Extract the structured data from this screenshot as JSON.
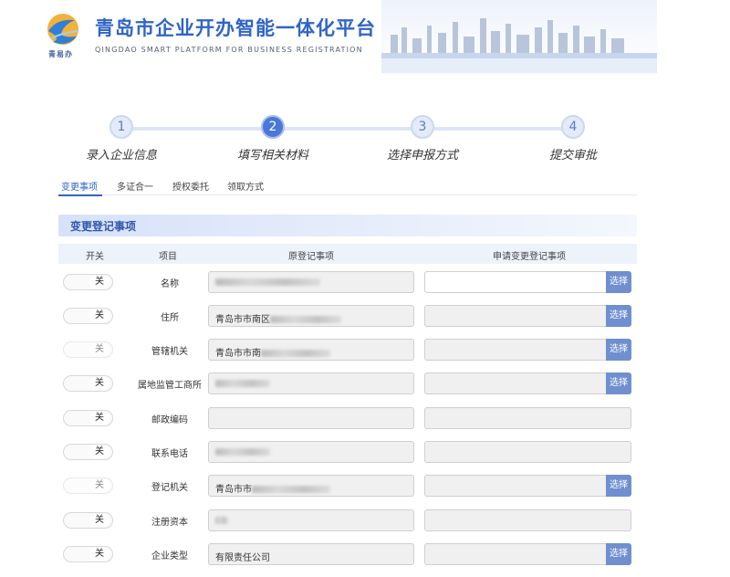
{
  "header": {
    "title": "青岛市企业开办智能一体化平台",
    "subtitle": "QINGDAO SMART PLATFORM FOR BUSINESS REGISTRATION",
    "logo_text": "青易办"
  },
  "steps": [
    {
      "num": "1",
      "label": "录入企业信息",
      "active": false
    },
    {
      "num": "2",
      "label": "填写相关材料",
      "active": true
    },
    {
      "num": "3",
      "label": "选择申报方式",
      "active": false
    },
    {
      "num": "4",
      "label": "提交审批",
      "active": false
    }
  ],
  "tabs": [
    "变更事项",
    "多证合一",
    "授权委托",
    "领取方式"
  ],
  "section": {
    "title": "变更登记事项",
    "columns": {
      "switch": "开关",
      "item": "项目",
      "original": "原登记事项",
      "requested": "申请变更登记事项"
    }
  },
  "rows": [
    {
      "toggle": "关",
      "label": "名称",
      "original": "",
      "has_choose": true,
      "choose": "选择"
    },
    {
      "toggle": "关",
      "label": "住所",
      "original": "青岛市市南区",
      "has_choose": true,
      "choose": "选择"
    },
    {
      "toggle": "关",
      "label": "管辖机关",
      "original": "青岛市市南",
      "has_choose": true,
      "choose": "选择"
    },
    {
      "toggle": "关",
      "label": "属地监管工商所",
      "original": "",
      "has_choose": true,
      "choose": "选择"
    },
    {
      "toggle": "关",
      "label": "邮政编码",
      "original": "",
      "has_choose": false,
      "choose": ""
    },
    {
      "toggle": "关",
      "label": "联系电话",
      "original": "",
      "has_choose": false,
      "choose": ""
    },
    {
      "toggle": "关",
      "label": "登记机关",
      "original": "青岛市市",
      "has_choose": true,
      "choose": "选择"
    },
    {
      "toggle": "关",
      "label": "注册资本",
      "original": "",
      "has_choose": false,
      "choose": ""
    },
    {
      "toggle": "关",
      "label": "企业类型",
      "original": "有限责任公司",
      "has_choose": true,
      "choose": "选择"
    }
  ],
  "colors": {
    "brand": "#2f64c8",
    "active_step": "#4a77d8",
    "choose_button": "#6f8fd0"
  }
}
